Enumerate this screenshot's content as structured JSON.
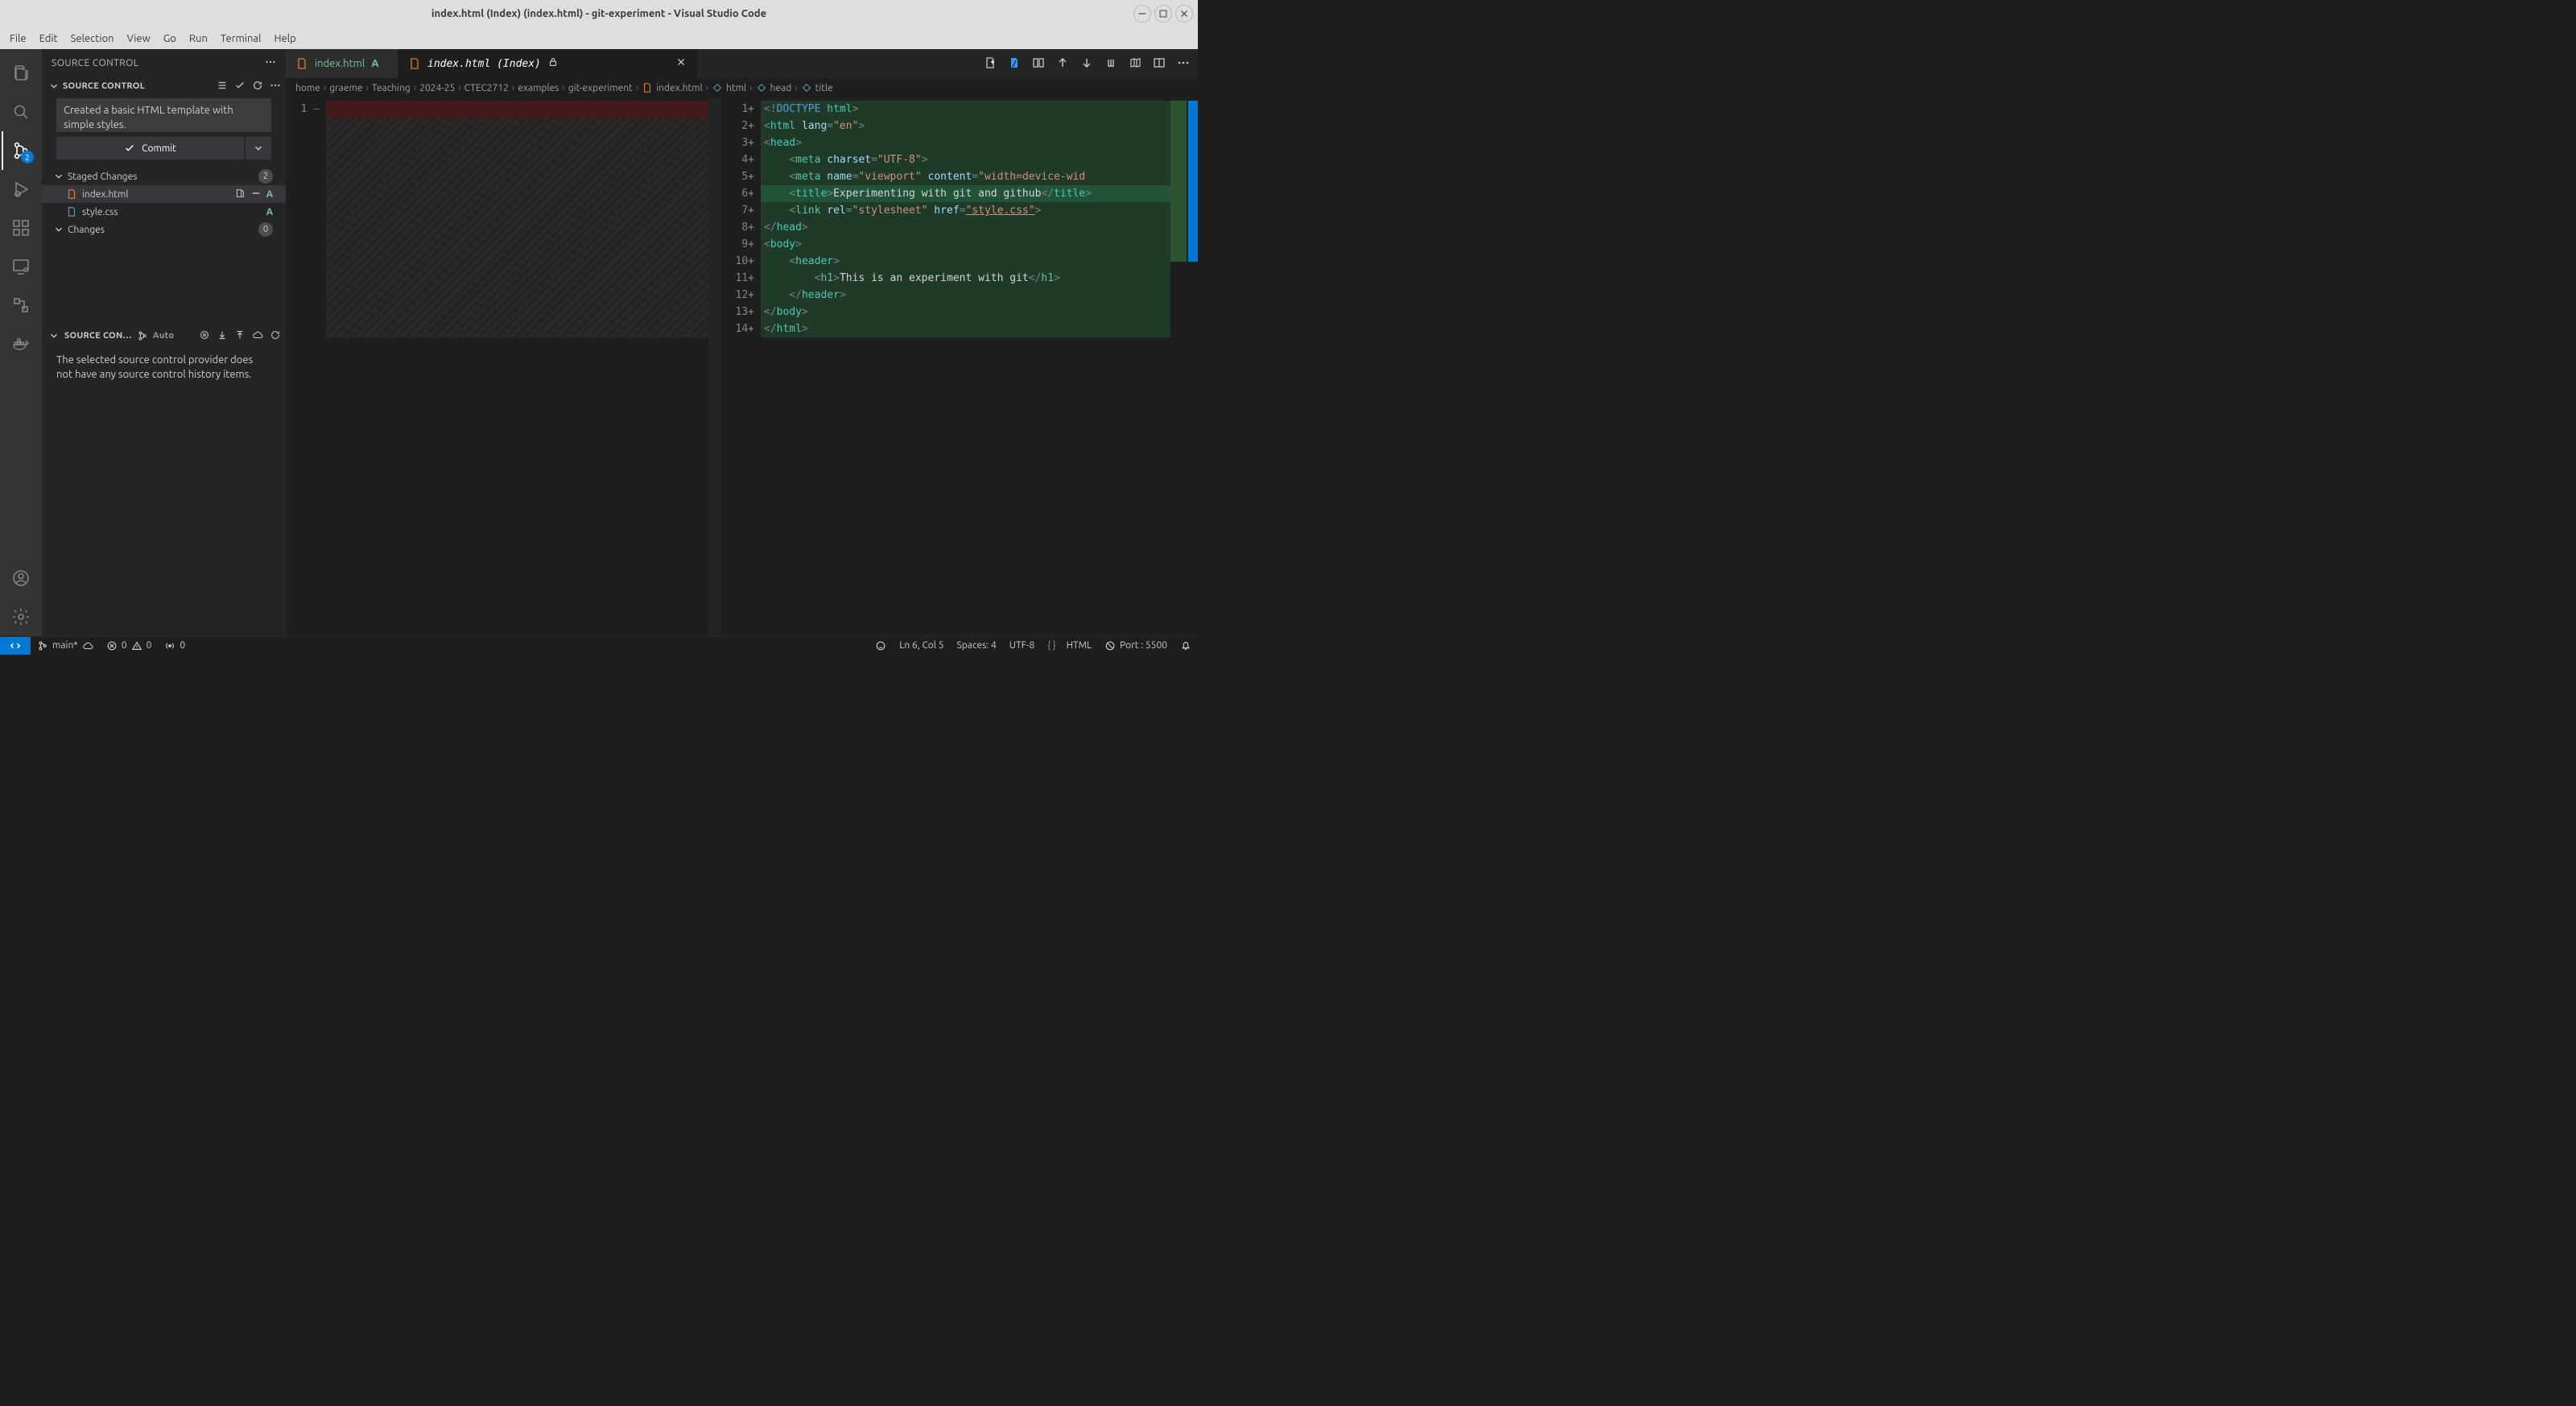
{
  "window": {
    "title": "index.html (Index) (index.html) - git-experiment - Visual Studio Code"
  },
  "menu": [
    "File",
    "Edit",
    "Selection",
    "View",
    "Go",
    "Run",
    "Terminal",
    "Help"
  ],
  "activity": {
    "scm_badge": "2"
  },
  "sidebar": {
    "title": "SOURCE CONTROL",
    "section_title": "SOURCE CONTROL",
    "commit_message": "Created a basic HTML template with simple styles.",
    "commit_button": "Commit",
    "staged": {
      "label": "Staged Changes",
      "count": "2",
      "items": [
        {
          "name": "index.html",
          "status": "A"
        },
        {
          "name": "style.css",
          "status": "A"
        }
      ]
    },
    "changes": {
      "label": "Changes",
      "count": "0"
    },
    "graph": {
      "title": "SOURCE CON…",
      "auto": "Auto",
      "message": "The selected source control provider does not have any source control history items."
    }
  },
  "tabs": {
    "left": {
      "name": "index.html",
      "status": "A"
    },
    "right": {
      "name": "index.html (Index)"
    }
  },
  "breadcrumb": [
    "home",
    "graeme",
    "Teaching",
    "2024-25",
    "CTEC2712",
    "examples",
    "git-experiment",
    "index.html",
    "html",
    "head",
    "title"
  ],
  "diff_left": {
    "linenos": [
      "1"
    ]
  },
  "diff_right": {
    "linenos": [
      "1",
      "2",
      "3",
      "4",
      "5",
      "6",
      "7",
      "8",
      "9",
      "10",
      "11",
      "12",
      "13",
      "14"
    ],
    "raw_lines": [
      "<!DOCTYPE html>",
      "<html lang=\"en\">",
      "<head>",
      "    <meta charset=\"UTF-8\">",
      "    <meta name=\"viewport\" content=\"width=device-wid",
      "    <title>Experimenting with git and github</title>",
      "    <link rel=\"stylesheet\" href=\"style.css\">",
      "</head>",
      "<body>",
      "    <header>",
      "        <h1>This is an experiment with git</h1>",
      "    </header>",
      "</body>",
      "</html>"
    ],
    "current_line_index": 5
  },
  "status": {
    "branch": "main*",
    "errors": "0",
    "warnings": "0",
    "ports": "0",
    "cursor": "Ln 6, Col 5",
    "spaces": "Spaces: 4",
    "encoding": "UTF-8",
    "lang": "HTML",
    "port": "Port : 5500"
  }
}
